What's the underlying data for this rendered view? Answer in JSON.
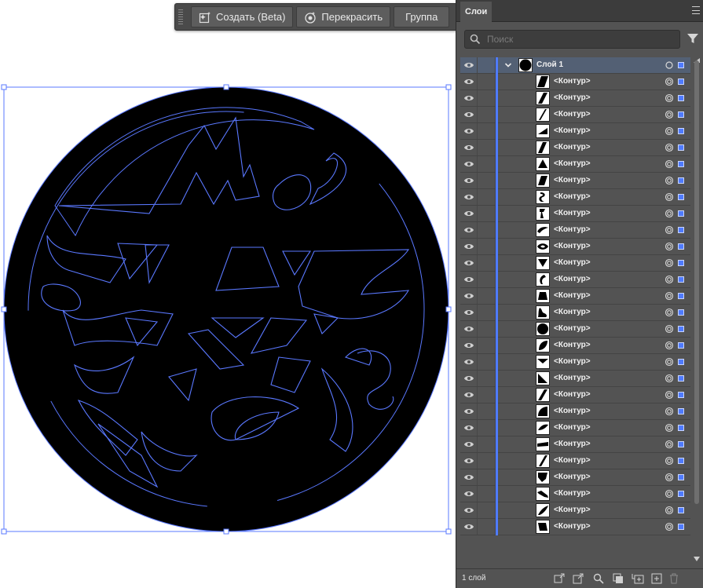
{
  "taskbar": {
    "generate_label": "Создать (Beta)",
    "recolor_label": "Перекрасить",
    "group_label": "Группа"
  },
  "layers_panel": {
    "tab_label": "Слои",
    "search_placeholder": "Поиск",
    "parent_layer": {
      "name": "Слой 1",
      "expanded": true
    },
    "items": [
      {
        "label": "<Контур>",
        "thumb": "shape-parallelogram"
      },
      {
        "label": "<Контур>",
        "thumb": "shape-slash"
      },
      {
        "label": "<Контур>",
        "thumb": "shape-thin-slash"
      },
      {
        "label": "<Контур>",
        "thumb": "shape-wedge"
      },
      {
        "label": "<Контур>",
        "thumb": "shape-slanted-bar"
      },
      {
        "label": "<Контур>",
        "thumb": "shape-triangle"
      },
      {
        "label": "<Контур>",
        "thumb": "shape-trapezoid"
      },
      {
        "label": "<Контур>",
        "thumb": "shape-curl"
      },
      {
        "label": "<Контур>",
        "thumb": "shape-hook"
      },
      {
        "label": "<Контур>",
        "thumb": "shape-swoosh"
      },
      {
        "label": "<Контур>",
        "thumb": "shape-eye"
      },
      {
        "label": "<Контур>",
        "thumb": "shape-down-triangle"
      },
      {
        "label": "<Контур>",
        "thumb": "shape-comma"
      },
      {
        "label": "<Контур>",
        "thumb": "shape-block"
      },
      {
        "label": "<Контур>",
        "thumb": "shape-flame"
      },
      {
        "label": "<Контур>",
        "thumb": "shape-circle"
      },
      {
        "label": "<Контур>",
        "thumb": "shape-leaf"
      },
      {
        "label": "<Контур>",
        "thumb": "shape-chevron"
      },
      {
        "label": "<Контур>",
        "thumb": "shape-corner"
      },
      {
        "label": "<Контур>",
        "thumb": "shape-diagonal"
      },
      {
        "label": "<Контур>",
        "thumb": "shape-half"
      },
      {
        "label": "<Контур>",
        "thumb": "shape-drop"
      },
      {
        "label": "<Контур>",
        "thumb": "shape-bar"
      },
      {
        "label": "<Контур>",
        "thumb": "shape-stroke"
      },
      {
        "label": "<Контур>",
        "thumb": "shape-pentagon"
      },
      {
        "label": "<Контур>",
        "thumb": "shape-zig"
      },
      {
        "label": "<Контур>",
        "thumb": "shape-tail"
      },
      {
        "label": "<Контур>",
        "thumb": "shape-box"
      }
    ],
    "footer_count": "1 слой"
  },
  "colors": {
    "panel_bg": "#535353",
    "parent_row_bg": "#536074",
    "layer_color": "#4f7bff",
    "artwork_fill": "#000000",
    "outline_stroke": "#5a78ff"
  }
}
